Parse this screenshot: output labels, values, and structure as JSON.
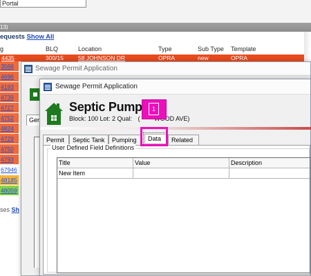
{
  "background": {
    "portal_label": "Portal",
    "section_header": "13)",
    "requests": {
      "title": "equests",
      "show_all": "Show All"
    },
    "columns": [
      "g",
      "BLQ",
      "Location",
      "Type",
      "Sub Type",
      "Template"
    ],
    "highlighted_row": {
      "blq": "300/15",
      "location": "58 JOHNSON DR",
      "type": "OPRA",
      "sub_type": "new",
      "template": "OPRA"
    },
    "left_cells": [
      {
        "text": "4435",
        "color": "#f06a3a"
      },
      {
        "text": "3566",
        "color": "#f06a3a"
      },
      {
        "text": "4696",
        "color": "#f06a3a"
      },
      {
        "text": "4193",
        "color": "#f06a3a"
      },
      {
        "text": "4739",
        "color": "#f06a3a"
      },
      {
        "text": "4727",
        "color": "#f06a3a"
      },
      {
        "text": "4752",
        "color": "#f06a3a"
      },
      {
        "text": "4824",
        "color": "#f06a3a"
      },
      {
        "text": "4729",
        "color": "#f06a3a"
      },
      {
        "text": "4750",
        "color": "#f06a3a"
      },
      {
        "text": "4793",
        "color": "#f06a3a"
      },
      {
        "text": "67946",
        "color": "#ffffff"
      },
      {
        "text": "48185",
        "color": "#f4b43c"
      },
      {
        "text": "48059",
        "color": "#8ad14a"
      }
    ],
    "ses_text": "ses",
    "ses_link": "Sh"
  },
  "window_back": {
    "title": "Sewage Permit Application",
    "tab": "Gen"
  },
  "window_front": {
    "title": "Sewage Permit Application",
    "app_title": "Septic Pump",
    "app_subtitle_left": "Block: 100 Lot: 2 Qual:",
    "app_subtitle_right": "WOOD AVE)",
    "tabs": [
      {
        "label": "Permit",
        "active": false
      },
      {
        "label": "Septic Tank",
        "active": false
      },
      {
        "label": "Pumping",
        "active": false
      },
      {
        "label": "Data",
        "active": true
      },
      {
        "label": "Related",
        "active": false
      }
    ],
    "group_label": "User Defined Field Definitions",
    "grid": {
      "columns": [
        "Title",
        "Value",
        "Description"
      ],
      "rows": [
        [
          "New Item",
          "",
          ""
        ]
      ]
    }
  },
  "callout": {
    "number": "1",
    "color": "#ee0fbc"
  },
  "colors": {
    "accent_red": "#e84a1c",
    "highlight_magenta": "#ee0fbc",
    "house_green": "#1f7a1f"
  },
  "icons": [
    "window-app-icon",
    "house-icon"
  ]
}
